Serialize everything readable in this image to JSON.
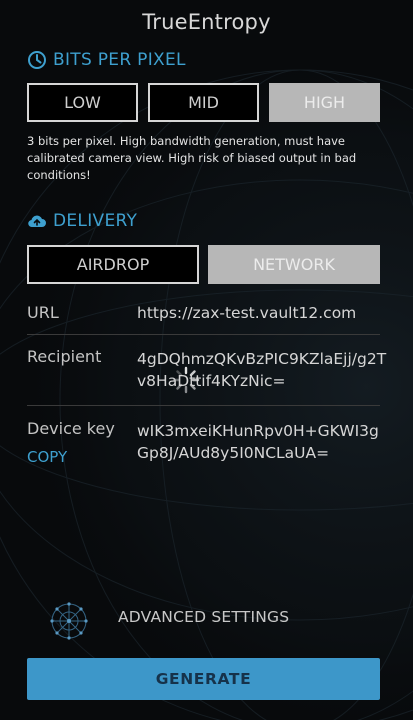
{
  "app": {
    "title": "TrueEntropy"
  },
  "bits_per_pixel": {
    "heading": "BITS PER PIXEL",
    "icon": "clock-icon",
    "options": [
      "LOW",
      "MID",
      "HIGH"
    ],
    "selected": "HIGH",
    "description": "3 bits per pixel. High bandwidth generation, must have calibrated camera view. High risk of biased output in bad conditions!"
  },
  "delivery": {
    "heading": "DELIVERY",
    "icon": "cloud-upload-icon",
    "options": [
      "AIRDROP",
      "NETWORK"
    ],
    "selected": "NETWORK"
  },
  "details": {
    "url_label": "URL",
    "url_value": "https://zax-test.vault12.com",
    "recipient_label": "Recipient",
    "recipient_value": "4gDQhmzQKvBzPIC9KZlaEjj/g2Tv8HaDttif4KYzNic=",
    "device_key_label": "Device key",
    "device_key_value": "wIK3mxeiKHunRpv0H+GKWI3gGp8J/AUd8y5I0NCLaUA=",
    "copy_label": "COPY"
  },
  "advanced": {
    "label": "ADVANCED SETTINGS",
    "icon": "network-icon"
  },
  "generate": {
    "label": "GENERATE"
  },
  "colors": {
    "accent": "#3ea0cf",
    "button_fill": "#3d97c9",
    "selected_fill": "#b7b7b7",
    "background": "#080a0c"
  }
}
